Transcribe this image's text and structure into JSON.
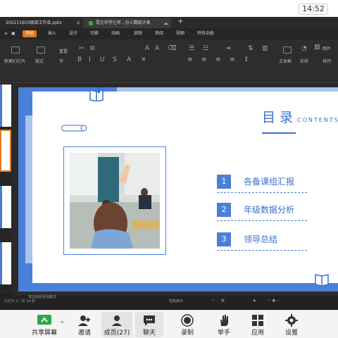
{
  "system": {
    "time": "14:52"
  },
  "tabs": [
    {
      "label": "202211603级部工作会.pptx"
    },
    {
      "label": "昆仑中学七年...分人数统计表"
    }
  ],
  "menu": [
    "开始",
    "插入",
    "设计",
    "切换",
    "动画",
    "放映",
    "审阅",
    "视图",
    "特色功能"
  ],
  "menu_active_index": 0,
  "ribbon": {
    "new_slide": "新建幻灯片",
    "layout": "版式",
    "section": "节",
    "reset": "重置",
    "textbox": "文本框",
    "shape": "形状",
    "picture": "图片",
    "arrange": "排列"
  },
  "slide": {
    "title": "目录",
    "contents_word": "CONTENTS",
    "items": [
      {
        "num": "1",
        "label": "各备课组汇报"
      },
      {
        "num": "2",
        "label": "年级数据分析"
      },
      {
        "num": "3",
        "label": "领导总结"
      }
    ]
  },
  "statusbar": {
    "left_text": "幻灯片 2 / 共 14 张",
    "notes_text": "单击此处添加备注",
    "right_text": "智能美化"
  },
  "meeting": {
    "share": "共享屏幕",
    "invite": "邀请",
    "members": "成员(27)",
    "chat": "聊天",
    "record": "录制",
    "raise_hand": "举手",
    "apps": "应用",
    "settings": "设置"
  },
  "colors": {
    "accent": "#4a80d8",
    "wps_orange": "#e07b1f",
    "share_green": "#2fa54d"
  }
}
